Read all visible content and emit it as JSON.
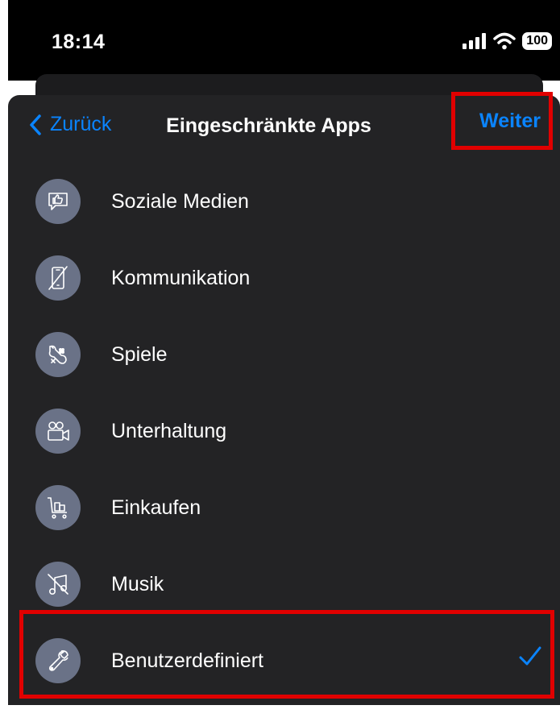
{
  "status_bar": {
    "time": "18:14",
    "battery": "100"
  },
  "nav": {
    "back_label": "Zurück",
    "title": "Eingeschränkte Apps",
    "next_label": "Weiter"
  },
  "categories": [
    {
      "label": "Soziale Medien",
      "icon": "social-like-icon"
    },
    {
      "label": "Kommunikation",
      "icon": "phone-slash-icon"
    },
    {
      "label": "Spiele",
      "icon": "gamepad-icon"
    },
    {
      "label": "Unterhaltung",
      "icon": "video-camera-icon"
    },
    {
      "label": "Einkaufen",
      "icon": "shopping-cart-icon"
    },
    {
      "label": "Musik",
      "icon": "music-off-icon"
    },
    {
      "label": "Benutzerdefiniert",
      "icon": "wrench-icon",
      "selected": true
    }
  ],
  "colors": {
    "accent": "#0a84ff",
    "highlight": "#e10000",
    "icon_bg": "#6a7287",
    "sheet_bg": "#232325"
  }
}
